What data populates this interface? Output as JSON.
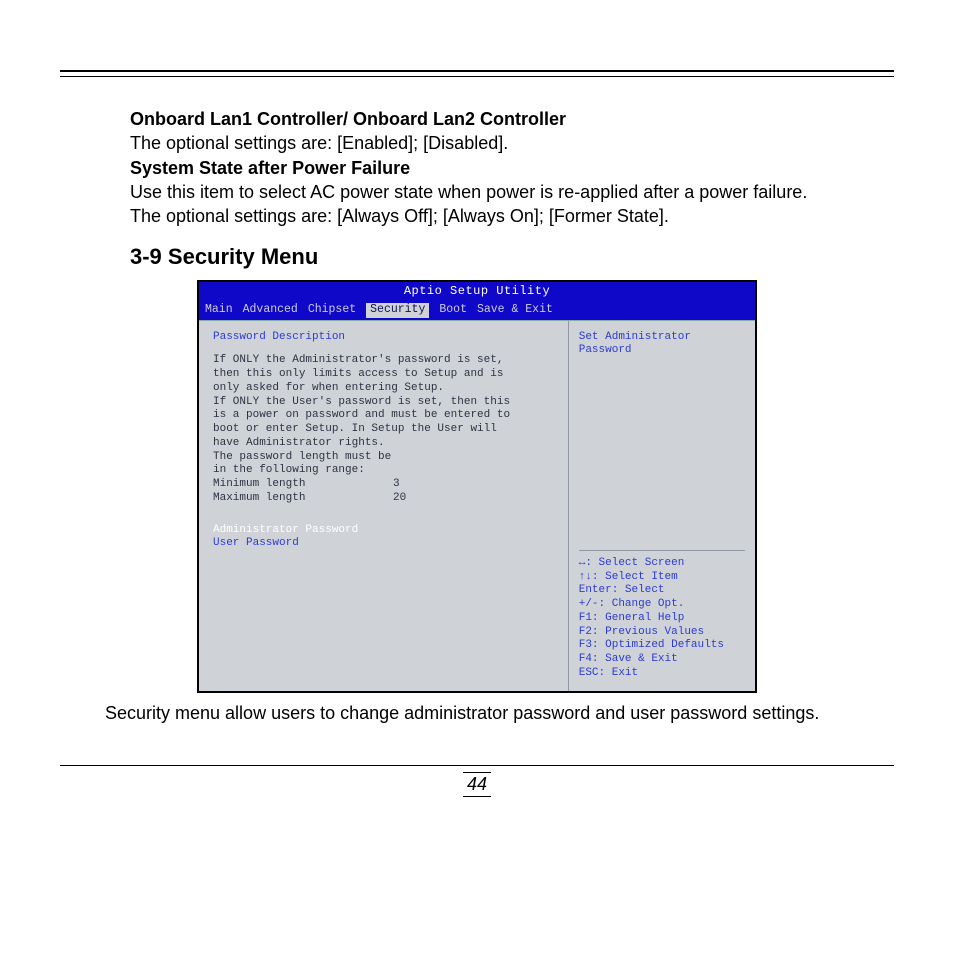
{
  "doc": {
    "h1": "Onboard Lan1 Controller/ Onboard Lan2 Controller",
    "p1": "The optional settings are: [Enabled]; [Disabled].",
    "h2": "System State after Power Failure",
    "p2": "Use this item to select AC power state when power is re-applied after a power failure.",
    "p3": "The optional settings are: [Always Off]; [Always On]; [Former State].",
    "section": "3-9 Security Menu",
    "p4": "Security menu allow users to change administrator password and user password settings.",
    "page_number": "44"
  },
  "bios": {
    "title": "Aptio Setup Utility",
    "tabs": [
      "Main",
      "Advanced",
      "Chipset",
      "Security",
      "Boot",
      "Save & Exit"
    ],
    "selected_tab": "Security",
    "left": {
      "header": "Password Description",
      "desc": [
        "If ONLY the Administrator's password is set,",
        "then this only limits access to Setup and is",
        "only asked for when entering Setup.",
        "If ONLY the User's password is set, then this",
        "is a power on password and must be entered to",
        "boot or enter Setup. In Setup the User will",
        "have Administrator rights.",
        "The password length must be",
        "in the following range:"
      ],
      "min_label": "Minimum length",
      "min_val": "3",
      "max_label": "Maximum length",
      "max_val": "20",
      "admin": "Administrator Password",
      "user": "User Password"
    },
    "right": {
      "help": "Set Administrator Password",
      "keys": [
        "↔: Select Screen",
        "↑↓: Select Item",
        "Enter: Select",
        "+/-: Change Opt.",
        "F1: General Help",
        "F2: Previous Values",
        "F3: Optimized Defaults",
        "F4: Save & Exit",
        "ESC: Exit"
      ]
    }
  }
}
